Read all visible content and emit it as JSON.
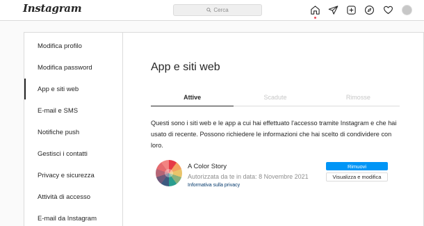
{
  "header": {
    "logo": "Instagram",
    "search_placeholder": "Cerca",
    "icons": [
      "home-icon",
      "direct-icon",
      "new-post-icon",
      "explore-icon",
      "activity-icon",
      "profile-avatar"
    ],
    "notification_dot_color": "#ed4956"
  },
  "sidebar": {
    "items": [
      {
        "label": "Modifica profilo"
      },
      {
        "label": "Modifica password"
      },
      {
        "label": "App e siti web",
        "active": true
      },
      {
        "label": "E-mail e SMS"
      },
      {
        "label": "Notifiche push"
      },
      {
        "label": "Gestisci i contatti"
      },
      {
        "label": "Privacy e sicurezza"
      },
      {
        "label": "Attività di accesso"
      },
      {
        "label": "E-mail da Instagram"
      }
    ]
  },
  "main": {
    "title": "App e siti web",
    "tabs": [
      {
        "label": "Attive",
        "active": true
      },
      {
        "label": "Scadute"
      },
      {
        "label": "Rimosse"
      }
    ],
    "description": "Questi sono i siti web e le app a cui hai effettuato l'accesso tramite Instagram e che hai usato di recente. Possono richiedere le informazioni che hai scelto di condividere con loro.",
    "app": {
      "name": "A Color Story",
      "authorized": "Autorizzata da te in data: 8 Novembre 2021",
      "privacy_link": "Informativa sulla privacy",
      "remove_label": "Rimuovi",
      "view_label": "Visualizza e modifica"
    }
  },
  "colors": {
    "accent": "#0095f6",
    "border": "#dbdbdb",
    "muted_text": "#8e8e8e",
    "inactive_tab": "#c7c7c7"
  }
}
